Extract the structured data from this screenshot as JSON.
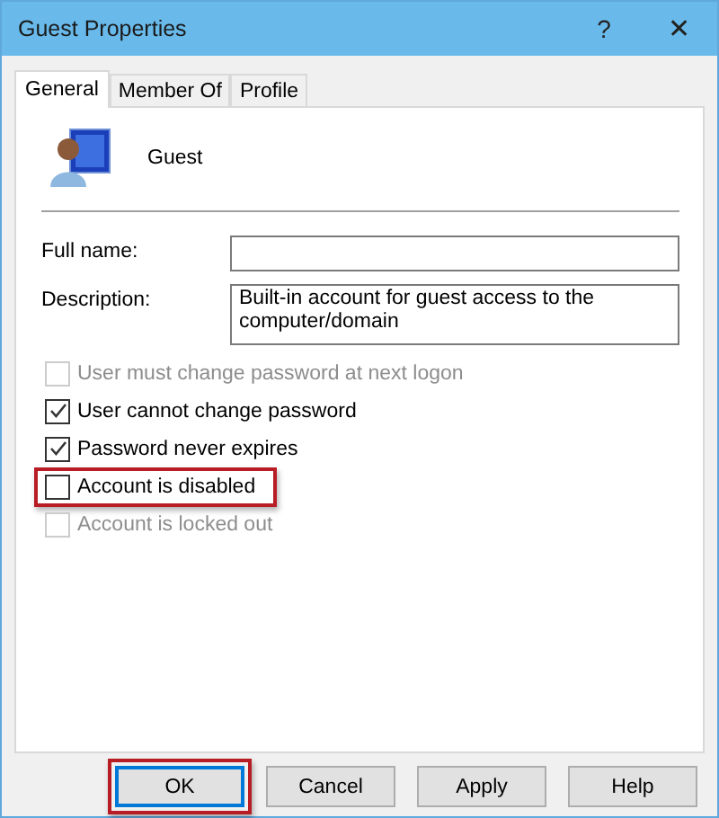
{
  "window": {
    "title": "Guest Properties",
    "help": "?",
    "close": "✕"
  },
  "tabs": [
    {
      "label": "General",
      "selected": true
    },
    {
      "label": "Member Of",
      "selected": false
    },
    {
      "label": "Profile",
      "selected": false
    }
  ],
  "user": {
    "name": "Guest"
  },
  "fields": [
    {
      "label": "Full name:",
      "multiline": false
    },
    {
      "label": "Description:",
      "value": "Built-in account for guest access to the computer/domain",
      "multiline": true
    }
  ],
  "options": [
    {
      "label": "User must change password at next logon",
      "checked": false,
      "disabled": true,
      "highlighted": false
    },
    {
      "label": "User cannot change password",
      "checked": true,
      "disabled": false,
      "highlighted": false
    },
    {
      "label": "Password never expires",
      "checked": true,
      "disabled": false,
      "highlighted": false
    },
    {
      "label": "Account is disabled",
      "checked": false,
      "disabled": false,
      "highlighted": true
    },
    {
      "label": "Account is locked out",
      "checked": false,
      "disabled": true,
      "highlighted": false
    }
  ],
  "buttons": [
    {
      "label": "OK",
      "default": true,
      "highlighted": true
    },
    {
      "label": "Cancel",
      "default": false,
      "highlighted": false
    },
    {
      "label": "Apply",
      "default": false,
      "highlighted": false
    },
    {
      "label": "Help",
      "default": false,
      "highlighted": false
    }
  ]
}
